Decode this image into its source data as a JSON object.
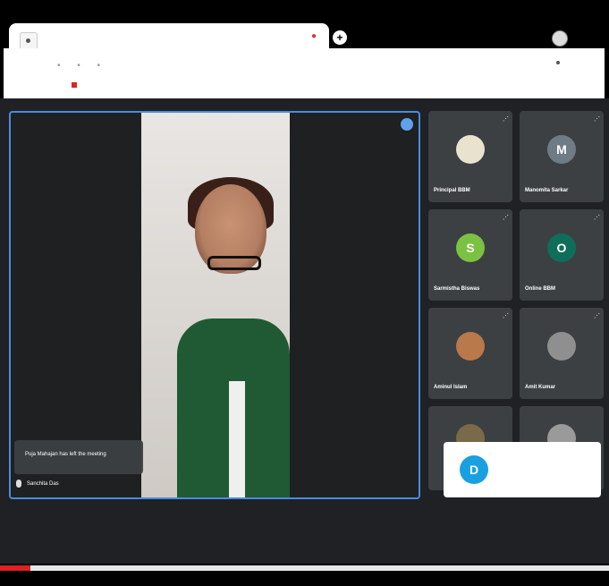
{
  "main": {
    "toast_text": "Puja Mahajan has left the meeting",
    "speaker_name": "Sanchita Das"
  },
  "participants": [
    {
      "name": "Principal BBM",
      "initial": "",
      "color": "#e8e2cf"
    },
    {
      "name": "Manomita Sarkar",
      "initial": "M",
      "color": "#6f7c86"
    },
    {
      "name": "Sarmistha Biswas",
      "initial": "S",
      "color": "#7cc242"
    },
    {
      "name": "Online BBM",
      "initial": "O",
      "color": "#0f6e5a"
    },
    {
      "name": "Aminul Islam",
      "initial": "",
      "color": "#b9794a"
    },
    {
      "name": "Amit Kumar",
      "initial": "",
      "color": "#8f8f8f"
    }
  ],
  "presenting": {
    "initial": "D",
    "color": "#19a0e0"
  },
  "progress": {
    "fraction": 0.05,
    "color": "#e02020"
  }
}
